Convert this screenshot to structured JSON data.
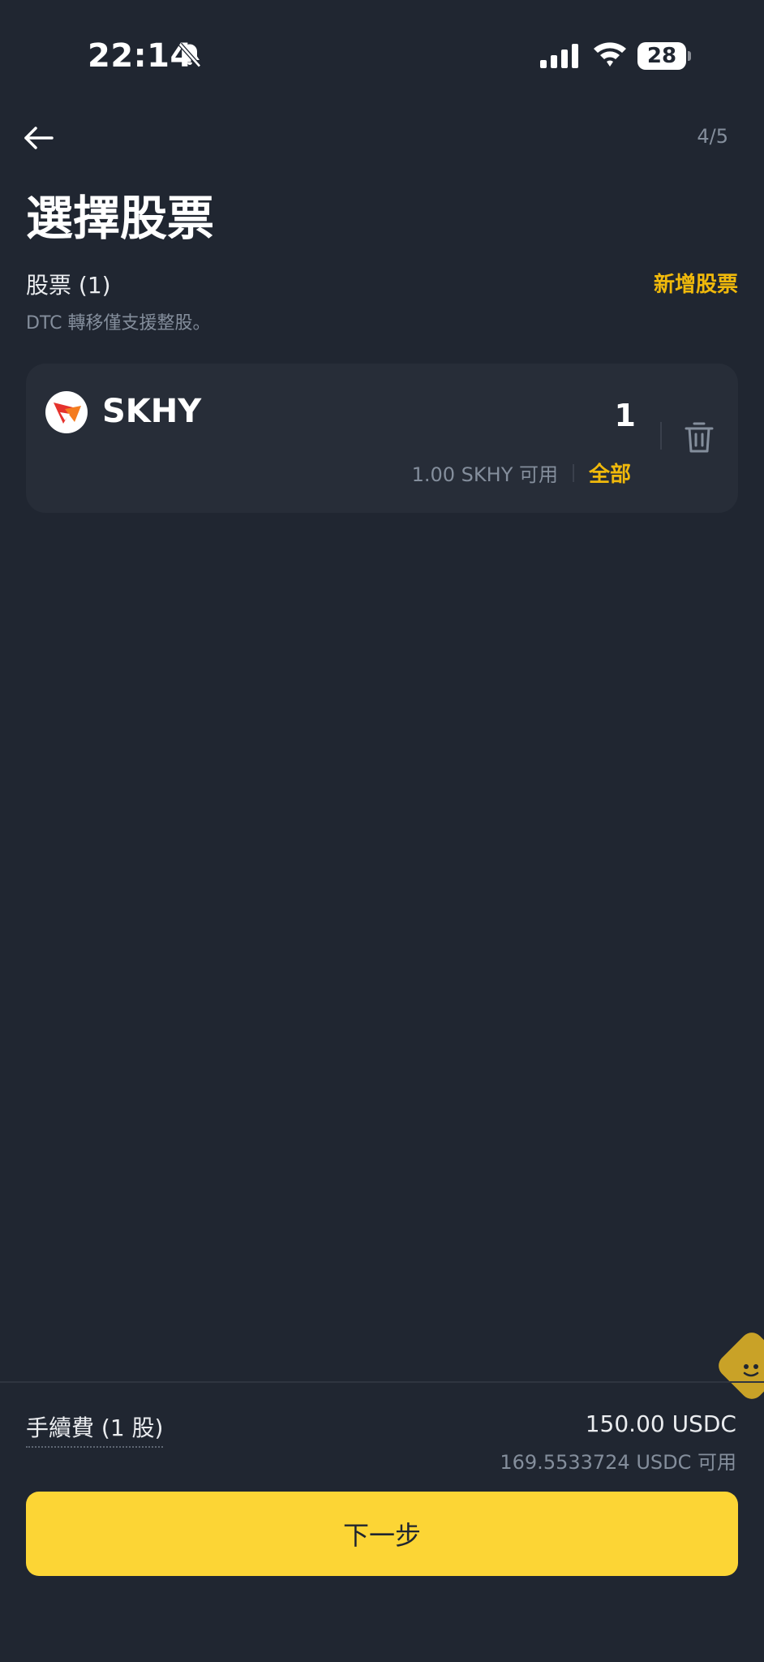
{
  "status_bar": {
    "time": "22:14",
    "battery": "28",
    "icons": [
      "bell-slash-icon",
      "signal-icon",
      "wifi-icon",
      "battery-icon"
    ]
  },
  "header": {
    "back_icon": "arrow-left-icon",
    "step": "4/5",
    "title": "選擇股票"
  },
  "stocks_section": {
    "label": "股票 (1)",
    "add_label": "新增股票",
    "hint": "DTC 轉移僅支援整股。"
  },
  "stock_card": {
    "symbol": "SKHY",
    "quantity": "1",
    "available": "1.00 SKHY 可用",
    "max_label": "全部",
    "logo_colors": [
      "#E5322D",
      "#F47C20"
    ],
    "delete_icon": "trash-icon"
  },
  "footer": {
    "fee_label": "手續費 (1 股)",
    "fee_value": "150.00 USDC",
    "fee_available": "169.5533724 USDC 可用",
    "next_label": "下一步"
  },
  "colors": {
    "background": "#202631",
    "card": "#272D38",
    "accent": "#F0B90B",
    "button": "#FCD535",
    "secondary_text": "#848E9C"
  }
}
